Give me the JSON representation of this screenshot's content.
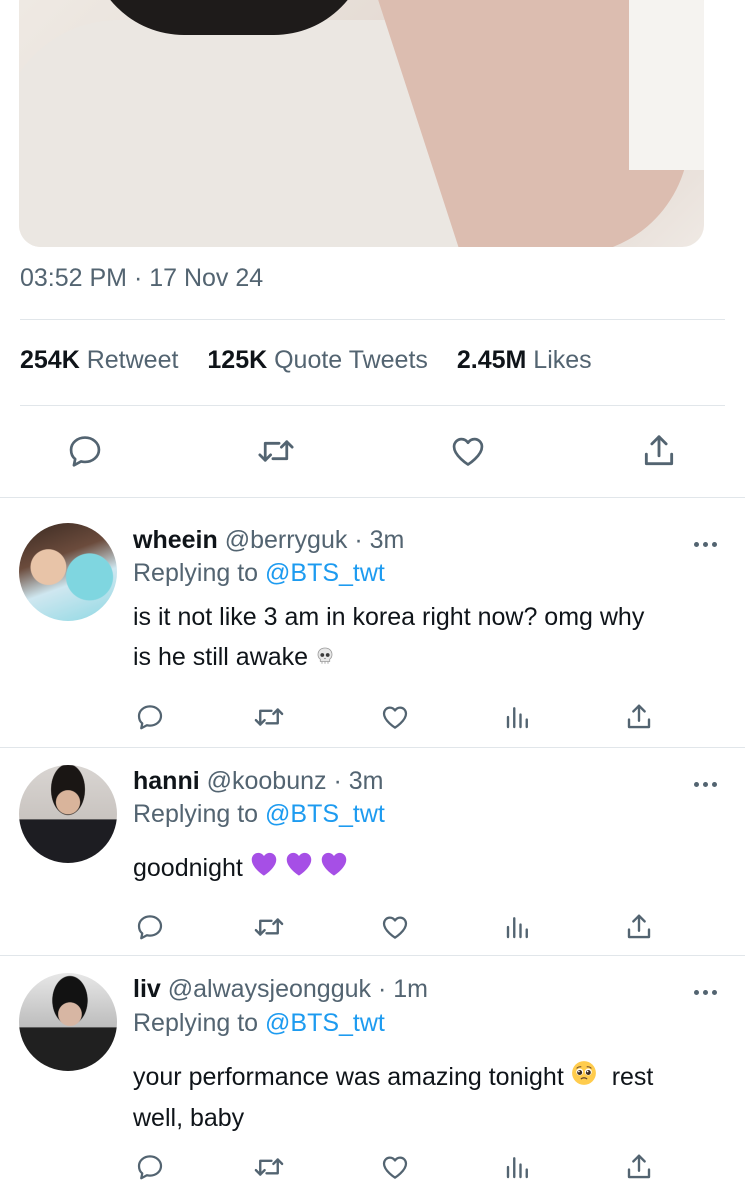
{
  "main_tweet": {
    "timestamp": "03:52 PM · 17 Nov 24",
    "stats": [
      {
        "count": "254K",
        "label": "Retweet"
      },
      {
        "count": "125K",
        "label": "Quote Tweets"
      },
      {
        "count": "2.45M",
        "label": "Likes"
      }
    ],
    "actions": [
      "reply-icon",
      "retweet-icon",
      "like-icon",
      "share-icon"
    ]
  },
  "replies": [
    {
      "name": "wheein",
      "handle": "@berryguk",
      "separator": "·",
      "age": "3m",
      "replying_prefix": "Replying to",
      "replying_to": "@BTS_twt",
      "text_lines": [
        "is it not like 3 am in korea right now? omg why",
        "is he still awake"
      ],
      "emoji": "skull"
    },
    {
      "name": "hanni",
      "handle": "@koobunz",
      "separator": "·",
      "age": "3m",
      "replying_prefix": "Replying to",
      "replying_to": "@BTS_twt",
      "text_lines": [
        "goodnight"
      ],
      "emoji": "purple-heart"
    },
    {
      "name": "liv",
      "handle": "@alwaysjeongguk",
      "separator": "·",
      "age": "1m",
      "replying_prefix": "Replying to",
      "replying_to": "@BTS_twt",
      "text_lines": [
        "your performance was amazing tonight",
        "rest",
        "well, baby"
      ],
      "emoji": "pleading-face"
    }
  ],
  "colors": {
    "text": "#0f1419",
    "secondary": "#536471",
    "link": "#1d9bf0",
    "divider": "#e1e6ea",
    "heart_purple": "#a64fe6"
  }
}
